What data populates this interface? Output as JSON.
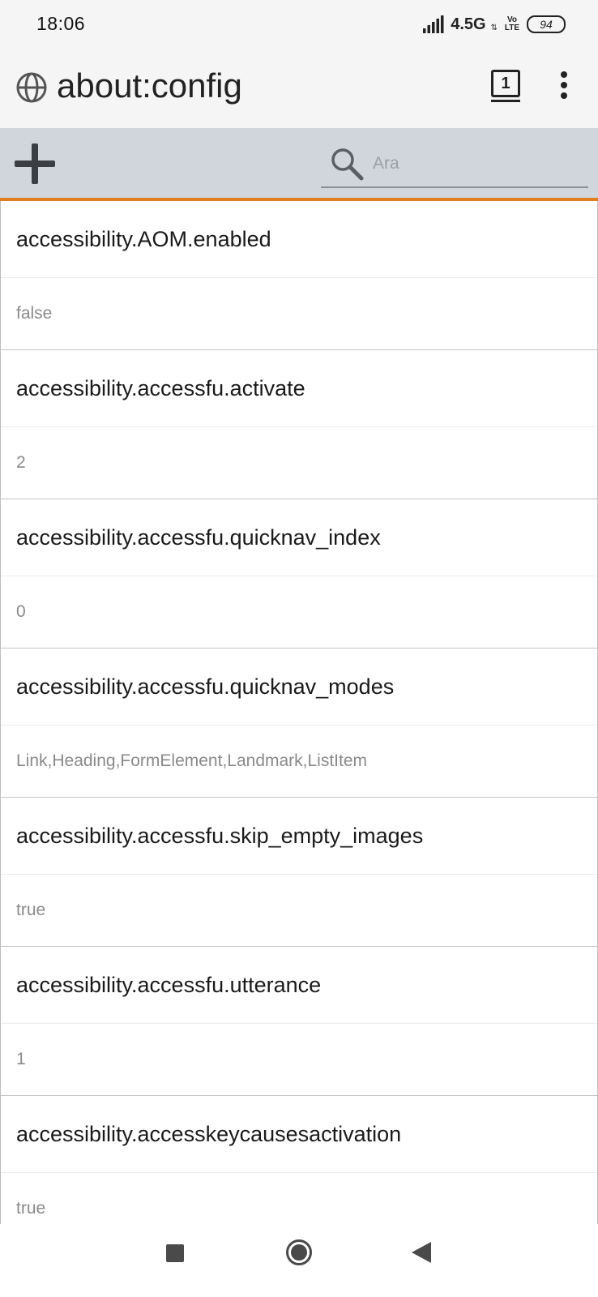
{
  "status_bar": {
    "time": "18:06",
    "network": "4.5G",
    "volte": "Vo LTE",
    "battery": "94"
  },
  "url_bar": {
    "url": "about:config",
    "tab_count": "1"
  },
  "toolbar": {
    "search_placeholder": "Ara"
  },
  "preferences": [
    {
      "name": "accessibility.AOM.enabled",
      "value": "false"
    },
    {
      "name": "accessibility.accessfu.activate",
      "value": "2"
    },
    {
      "name": "accessibility.accessfu.quicknav_index",
      "value": "0"
    },
    {
      "name": "accessibility.accessfu.quicknav_modes",
      "value": "Link,Heading,FormElement,Landmark,ListItem"
    },
    {
      "name": "accessibility.accessfu.skip_empty_images",
      "value": "true"
    },
    {
      "name": "accessibility.accessfu.utterance",
      "value": "1"
    },
    {
      "name": "accessibility.accesskeycausesactivation",
      "value": "true"
    }
  ],
  "icons": {
    "signal": "signal-icon",
    "battery": "battery-icon",
    "globe": "globe-icon",
    "tabs": "tabs-icon",
    "menu": "overflow-menu-icon",
    "add": "plus-icon",
    "search": "search-icon",
    "recents": "square-icon",
    "home": "circle-icon",
    "back": "triangle-back-icon"
  },
  "colors": {
    "toolbar_bg": "#d0d6dc",
    "toolbar_accent": "#e07d20",
    "chrome_bg": "#f5f5f5"
  }
}
